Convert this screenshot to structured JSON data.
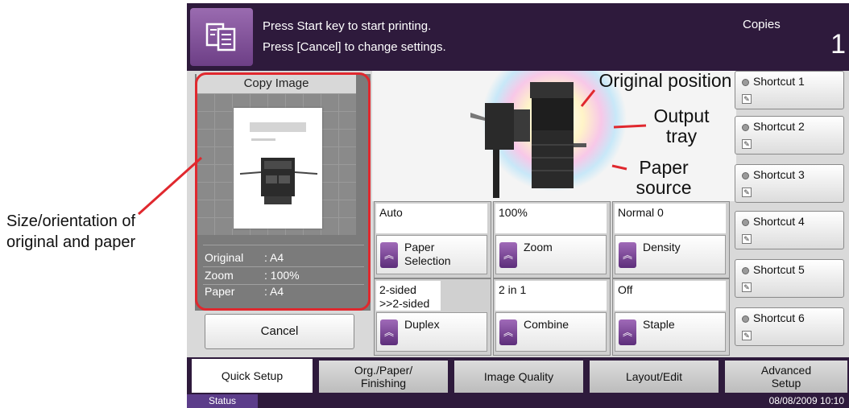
{
  "callouts": {
    "size_orientation": "Size/orientation of original and paper",
    "original_position": "Original position",
    "output_tray": "Output tray",
    "paper_source": "Paper source"
  },
  "header": {
    "line1": "Press Start key to start printing.",
    "line2": "Press [Cancel] to change settings.",
    "copies_label": "Copies",
    "copies_value": "1",
    "icon": "copy-icon"
  },
  "preview": {
    "title": "Copy Image",
    "rows": [
      {
        "label": "Original",
        "value": ": A4"
      },
      {
        "label": "Zoom",
        "value": ": 100%"
      },
      {
        "label": "Paper",
        "value": ": A4"
      }
    ],
    "cancel_label": "Cancel"
  },
  "settings": [
    {
      "value": "Auto",
      "label": "Paper Selection"
    },
    {
      "value": "100%",
      "label": "Zoom"
    },
    {
      "value": "Normal 0",
      "label": "Density"
    },
    {
      "value": "2-sided >>2-sided",
      "label": "Duplex"
    },
    {
      "value": "2 in 1",
      "label": "Combine"
    },
    {
      "value": "Off",
      "label": "Staple"
    }
  ],
  "shortcuts": [
    "Shortcut 1",
    "Shortcut 2",
    "Shortcut 3",
    "Shortcut 4",
    "Shortcut 5",
    "Shortcut 6"
  ],
  "tabs": [
    "Quick Setup",
    "Org./Paper/ Finishing",
    "Image Quality",
    "Layout/Edit",
    "Advanced Setup"
  ],
  "status": {
    "button": "Status",
    "datetime": "08/08/2009   10:10"
  },
  "colors": {
    "header_bg": "#2e1a3c",
    "accent_purple": "#6d3f86",
    "callout_line": "#e0282e"
  }
}
